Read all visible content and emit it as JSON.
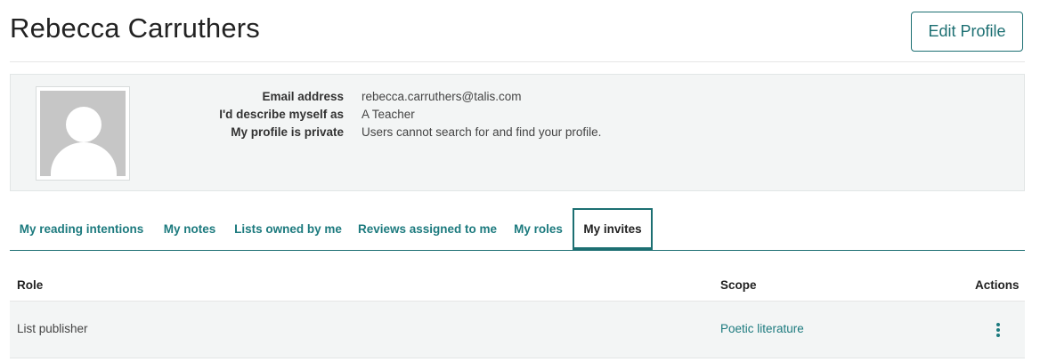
{
  "profile": {
    "name": "Rebecca Carruthers",
    "edit_label": "Edit Profile",
    "details": [
      {
        "label": "Email address",
        "value": "rebecca.carruthers@talis.com"
      },
      {
        "label": "I'd describe myself as",
        "value": "A Teacher"
      },
      {
        "label": "My profile is private",
        "value": "Users cannot search for and find your profile."
      }
    ]
  },
  "tabs": [
    {
      "label": "My reading intentions",
      "active": false
    },
    {
      "label": "My notes",
      "active": false
    },
    {
      "label": "Lists owned by me",
      "active": false
    },
    {
      "label": "Reviews assigned to me",
      "active": false
    },
    {
      "label": "My roles",
      "active": false
    },
    {
      "label": "My invites",
      "active": true
    }
  ],
  "table": {
    "columns": [
      "Role",
      "Scope",
      "Actions"
    ],
    "rows": [
      {
        "role": "List publisher",
        "scope": "Poetic literature",
        "action_icon": "kebab-menu-icon"
      }
    ]
  },
  "colors": {
    "accent": "#1c6f72",
    "link": "#1c7a7e",
    "panel_bg": "#f3f5f5"
  }
}
